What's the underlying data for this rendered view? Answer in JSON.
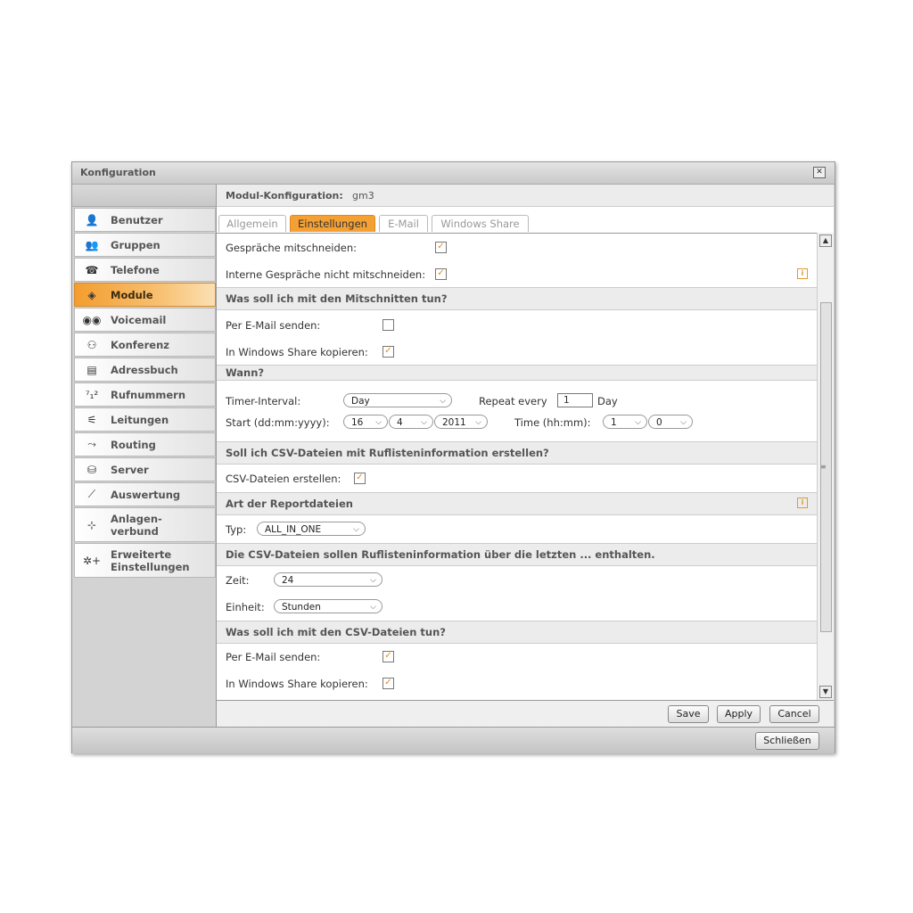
{
  "window": {
    "title": "Konfiguration",
    "close_icon": "close-icon"
  },
  "sidebar": {
    "items": [
      {
        "label": "Benutzer",
        "icon": "👤"
      },
      {
        "label": "Gruppen",
        "icon": "👥"
      },
      {
        "label": "Telefone",
        "icon": "☎"
      },
      {
        "label": "Module",
        "icon": "◈"
      },
      {
        "label": "Voicemail",
        "icon": "◉◉"
      },
      {
        "label": "Konferenz",
        "icon": "⚇"
      },
      {
        "label": "Adressbuch",
        "icon": "▤"
      },
      {
        "label": "Rufnummern",
        "icon": "⁷₁²"
      },
      {
        "label": "Leitungen",
        "icon": "⚟"
      },
      {
        "label": "Routing",
        "icon": "⤳"
      },
      {
        "label": "Server",
        "icon": "⛁"
      },
      {
        "label": "Auswertung",
        "icon": "⟋"
      },
      {
        "label1": "Anlagen-",
        "label2": "verbund",
        "icon": "⊹"
      },
      {
        "label1": "Erweiterte",
        "label2": "Einstellungen",
        "icon": "✲+"
      }
    ]
  },
  "main": {
    "head_label": "Modul-Konfiguration:",
    "head_value": "gm3",
    "tabs": [
      "Allgemein",
      "Einstellungen",
      "E-Mail",
      "Windows Share"
    ]
  },
  "form": {
    "record_calls": "Gespräche mitschneiden:",
    "no_internal": "Interne Gespräche nicht mitschneiden:",
    "sec1": "Was soll ich mit den Mitschnitten tun?",
    "email1": "Per E-Mail senden:",
    "share1": "In Windows Share kopieren:",
    "sec2": "Wann?",
    "timer_label": "Timer-Interval:",
    "timer_value": "Day",
    "repeat_label": "Repeat every",
    "repeat_value": "1",
    "repeat_unit": "Day",
    "start_label": "Start (dd:mm:yyyy):",
    "start_day": "16",
    "start_month": "4",
    "start_year": "2011",
    "time_label": "Time (hh:mm):",
    "time_h": "1",
    "time_m": "0",
    "sec3": "Soll ich CSV-Dateien mit Ruflisteninformation erstellen?",
    "csv_label": "CSV-Dateien erstellen:",
    "sec4": "Art der Reportdateien",
    "typ_label": "Typ:",
    "typ_value": "ALL_IN_ONE",
    "sec5": "Die CSV-Dateien sollen Ruflisteninformation über die letzten ... enthalten.",
    "zeit_label": "Zeit:",
    "zeit_value": "24",
    "einheit_label": "Einheit:",
    "einheit_value": "Stunden",
    "sec6": "Was soll ich mit den CSV-Dateien tun?",
    "email2": "Per E-Mail senden:",
    "share2": "In Windows Share kopieren:"
  },
  "buttons": {
    "save": "Save",
    "apply": "Apply",
    "cancel": "Cancel",
    "close": "Schließen"
  },
  "glyphs": {
    "check": "✓",
    "caret": "⌵",
    "info": "i",
    "close": "✕",
    "up": "▲",
    "down": "▼",
    "grip": "≡"
  },
  "colors": {
    "accent": "#f5a033"
  }
}
